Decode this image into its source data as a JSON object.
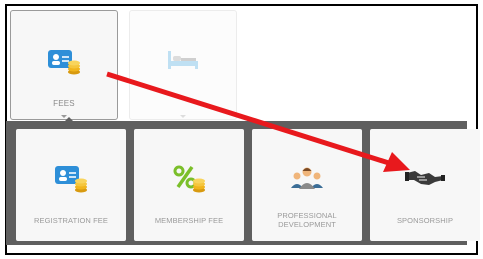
{
  "top_menu": {
    "items": [
      {
        "label": "FEES",
        "icon": "id-card-coins-icon",
        "state": "selected"
      },
      {
        "label": "",
        "icon": "bed-icon",
        "state": "disabled"
      }
    ]
  },
  "submenu": {
    "items": [
      {
        "label": "REGISTRATION FEE",
        "icon": "id-card-coins-icon"
      },
      {
        "label": "MEMBERSHIP FEE",
        "icon": "percent-coins-icon"
      },
      {
        "label_line1": "PROFESSIONAL",
        "label_line2": "DEVELOPMENT",
        "icon": "group-people-icon"
      },
      {
        "label": "SPONSORSHIP",
        "icon": "handshake-icon"
      }
    ]
  },
  "annotation": {
    "type": "arrow",
    "color": "#e8191d"
  },
  "colors": {
    "tile_bg": "#f7f7f7",
    "panel_bg": "#5f5f5f",
    "accent_blue": "#2e8fd8",
    "coin": "#f1b51c"
  }
}
